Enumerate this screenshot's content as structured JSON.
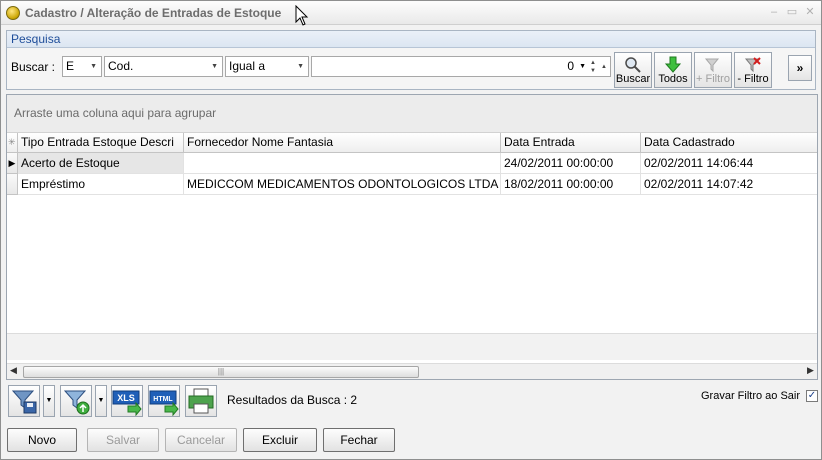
{
  "window": {
    "title": "Cadastro / Alteração de Entradas de Estoque"
  },
  "search": {
    "panel_title": "Pesquisa",
    "buscar_label": "Buscar :",
    "type_value": "E",
    "field_value": "Cod.",
    "operator_value": "Igual a",
    "value": "0",
    "buttons": {
      "buscar": "Buscar",
      "todos": "Todos",
      "add_filtro": "+ Filtro",
      "remove_filtro": "- Filtro"
    }
  },
  "grid": {
    "group_hint": "Arraste uma coluna aqui para agrupar",
    "columns": [
      "Tipo Entrada Estoque Descri",
      "Fornecedor Nome Fantasia",
      "Data Entrada",
      "Data Cadastrado"
    ],
    "rows": [
      [
        "Acerto de Estoque",
        "",
        "24/02/2011 00:00:00",
        "02/02/2011 14:06:44"
      ],
      [
        "Empréstimo",
        "MEDICCOM MEDICAMENTOS ODONTOLOGICOS LTDA",
        "18/02/2011 00:00:00",
        "02/02/2011 14:07:42"
      ]
    ]
  },
  "bottom": {
    "results_label": "Resultados da Busca : 2",
    "gravar_filtro": "Gravar Filtro ao Sair",
    "gravar_checked": "✓",
    "xls_label": "XLS",
    "html_label": "HTML"
  },
  "actions": {
    "novo": "Novo",
    "salvar": "Salvar",
    "cancelar": "Cancelar",
    "excluir": "Excluir",
    "fechar": "Fechar"
  },
  "colors": {
    "panel_title": "#1f4e9a",
    "selected_row": "#e6e6e6"
  }
}
